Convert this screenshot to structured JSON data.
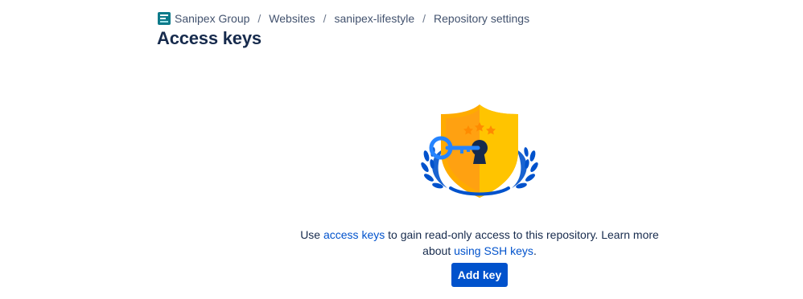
{
  "breadcrumb": {
    "workspace_icon": "workspace-logo-icon",
    "items": [
      "Sanipex Group",
      "Websites",
      "sanipex-lifestyle",
      "Repository settings"
    ],
    "separator": "/"
  },
  "page": {
    "title": "Access keys"
  },
  "empty_state": {
    "illustration_icon": "shield-key-icon",
    "text_1": "Use ",
    "link_access_keys": "access keys",
    "text_2": " to gain read-only access to this repository. Learn more about ",
    "link_ssh_keys": "using SSH keys",
    "text_3": "."
  },
  "actions": {
    "add_key_label": "Add key"
  },
  "colors": {
    "primary": "#0052cc",
    "text": "#172b4d",
    "muted": "#42526e",
    "shield": "#ffab00"
  }
}
